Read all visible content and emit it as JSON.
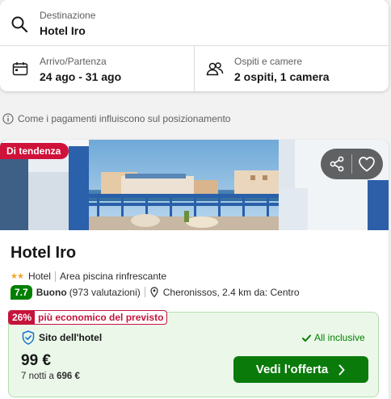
{
  "search": {
    "destination": {
      "label": "Destinazione",
      "value": "Hotel Iro",
      "icon": "search-icon"
    },
    "dates": {
      "label": "Arrivo/Partenza",
      "value": "24 ago - 31 ago",
      "icon": "calendar-icon"
    },
    "guests": {
      "label": "Ospiti e camere",
      "value": "2 ospiti, 1 camera",
      "icon": "guests-icon"
    }
  },
  "info": {
    "text": "Come i pagamenti influiscono sul posizionamento",
    "icon": "info-icon"
  },
  "hotel": {
    "badge": "Di tendenza",
    "name": "Hotel Iro",
    "stars": 2,
    "type": "Hotel",
    "feature": "Area piscina rinfrescante",
    "score": "7.7",
    "rating_word": "Buono",
    "reviews": "(973 valutazioni)",
    "location": "Cheronissos, 2.4 km da: Centro"
  },
  "offer": {
    "deal_percent": "26%",
    "deal_text": "più economico del previsto",
    "site": "Sito dell'hotel",
    "inclusion": "All inclusive",
    "price": "99 €",
    "total_prefix": "7 notti a",
    "total_value": "696 €",
    "cta": "Vedi l'offerta"
  },
  "colors": {
    "trend_badge": "#d0113a",
    "score_badge": "#007f00",
    "offer_bg": "#ebf8e9",
    "cta": "#0a7a0a",
    "deal": "#c5143b",
    "stars": "#f3a32c"
  }
}
